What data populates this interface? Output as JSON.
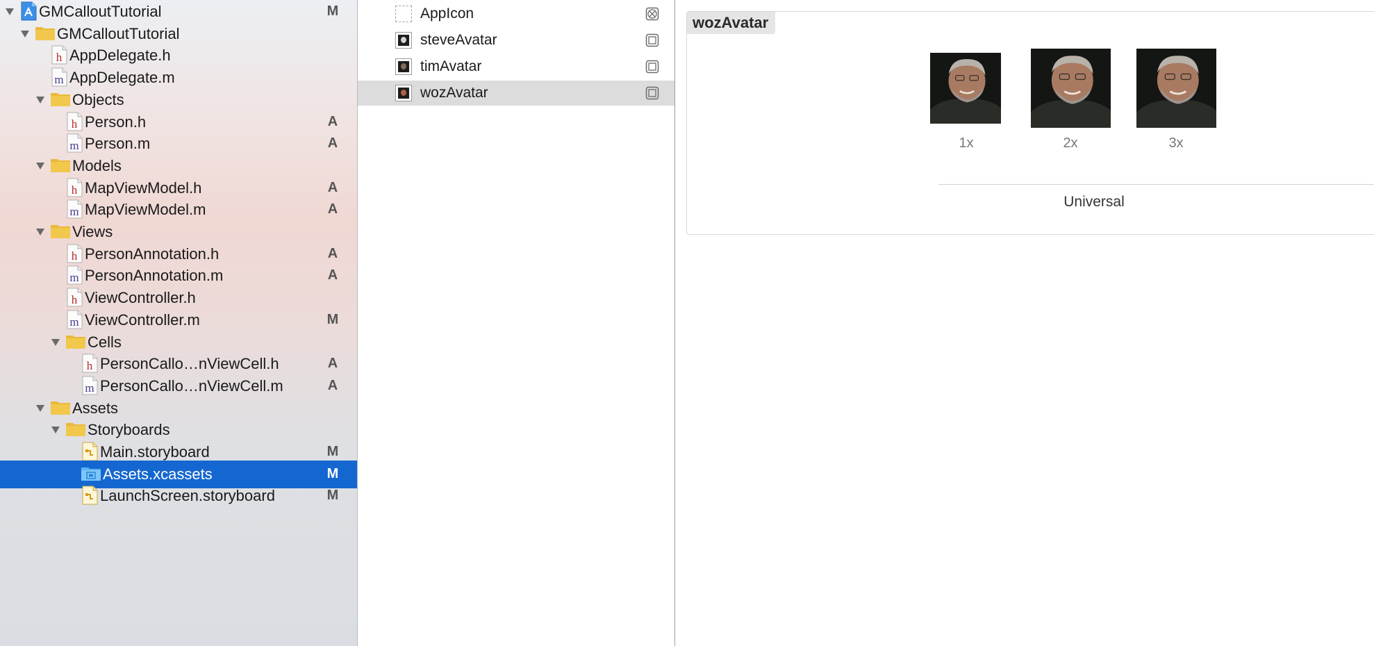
{
  "navigator": {
    "rows": [
      {
        "label": "GMCalloutTutorial",
        "type": "project",
        "depth": 0,
        "expanded": true,
        "badge": "M"
      },
      {
        "label": "GMCalloutTutorial",
        "type": "folder",
        "depth": 1,
        "expanded": true,
        "badge": ""
      },
      {
        "label": "AppDelegate.h",
        "type": "h",
        "depth": 2,
        "badge": ""
      },
      {
        "label": "AppDelegate.m",
        "type": "m",
        "depth": 2,
        "badge": ""
      },
      {
        "label": "Objects",
        "type": "folder",
        "depth": 2,
        "expanded": true,
        "badge": ""
      },
      {
        "label": "Person.h",
        "type": "h",
        "depth": 3,
        "badge": "A"
      },
      {
        "label": "Person.m",
        "type": "m",
        "depth": 3,
        "badge": "A"
      },
      {
        "label": "Models",
        "type": "folder",
        "depth": 2,
        "expanded": true,
        "badge": ""
      },
      {
        "label": "MapViewModel.h",
        "type": "h",
        "depth": 3,
        "badge": "A"
      },
      {
        "label": "MapViewModel.m",
        "type": "m",
        "depth": 3,
        "badge": "A"
      },
      {
        "label": "Views",
        "type": "folder",
        "depth": 2,
        "expanded": true,
        "badge": ""
      },
      {
        "label": "PersonAnnotation.h",
        "type": "h",
        "depth": 3,
        "badge": "A"
      },
      {
        "label": "PersonAnnotation.m",
        "type": "m",
        "depth": 3,
        "badge": "A"
      },
      {
        "label": "ViewController.h",
        "type": "h",
        "depth": 3,
        "badge": ""
      },
      {
        "label": "ViewController.m",
        "type": "m",
        "depth": 3,
        "badge": "M"
      },
      {
        "label": "Cells",
        "type": "folder",
        "depth": 3,
        "expanded": true,
        "badge": ""
      },
      {
        "label": "PersonCallo…nViewCell.h",
        "type": "h",
        "depth": 4,
        "badge": "A"
      },
      {
        "label": "PersonCallo…nViewCell.m",
        "type": "m",
        "depth": 4,
        "badge": "A"
      },
      {
        "label": "Assets",
        "type": "folder",
        "depth": 2,
        "expanded": true,
        "badge": ""
      },
      {
        "label": "Storyboards",
        "type": "folder",
        "depth": 3,
        "expanded": true,
        "badge": ""
      },
      {
        "label": "Main.storyboard",
        "type": "storyboard",
        "depth": 4,
        "badge": "M"
      },
      {
        "label": "Assets.xcassets",
        "type": "xcassets",
        "depth": 4,
        "badge": "M",
        "selected": true
      },
      {
        "label": "LaunchScreen.storyboard",
        "type": "storyboard",
        "depth": 4,
        "badge": "M"
      }
    ]
  },
  "asset_list": {
    "items": [
      {
        "label": "AppIcon",
        "kind": "appicon"
      },
      {
        "label": "steveAvatar",
        "kind": "image",
        "face": "#d9d2cc"
      },
      {
        "label": "timAvatar",
        "kind": "image",
        "face": "#8a6a5a"
      },
      {
        "label": "wozAvatar",
        "kind": "image",
        "face": "#b0604a",
        "selected": true
      }
    ]
  },
  "editor": {
    "set_name": "wozAvatar",
    "slots": [
      {
        "label": "1x"
      },
      {
        "label": "2x"
      },
      {
        "label": "3x"
      }
    ],
    "device_group": "Universal"
  },
  "colors": {
    "selection": "#1467d0",
    "folder": "#f1c84c",
    "header_h": "#b52b2b",
    "impl_m": "#4a3d8f"
  }
}
